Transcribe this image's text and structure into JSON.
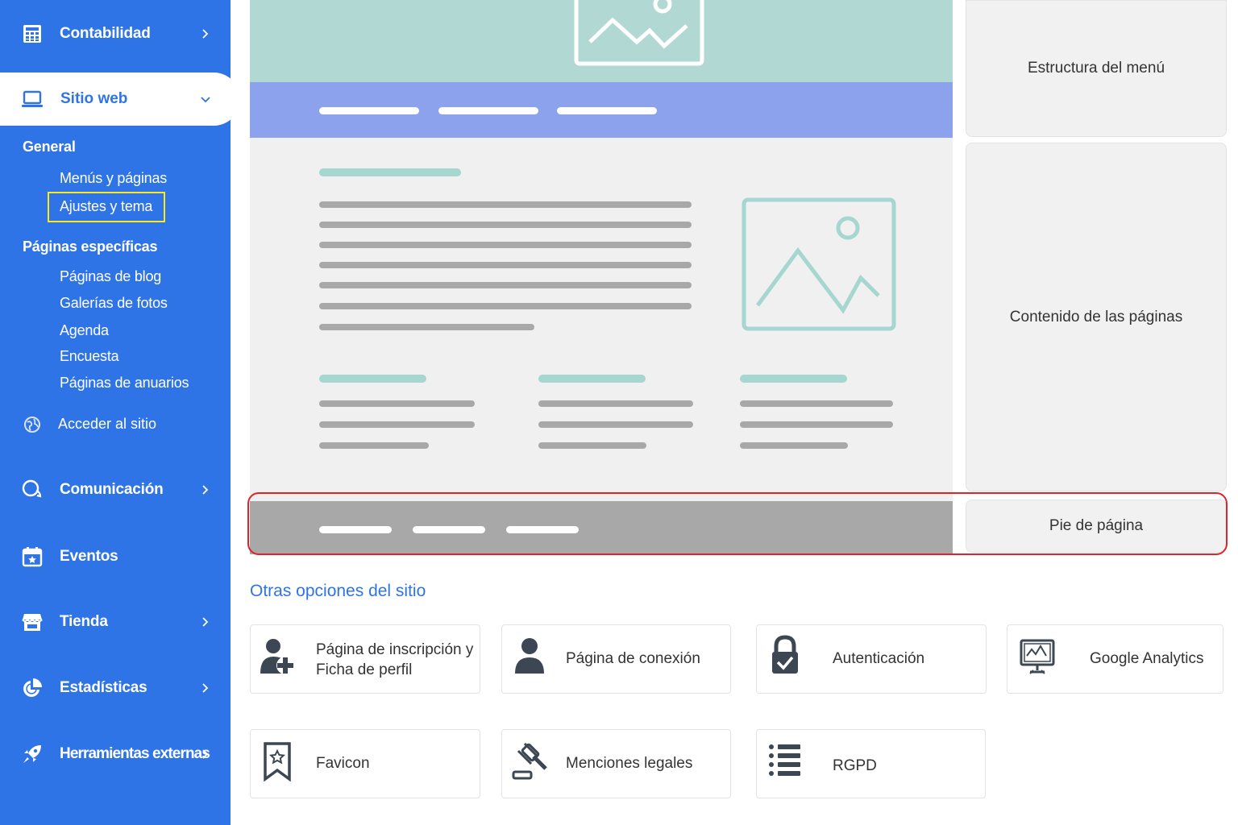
{
  "sidebar": {
    "contabilidad": "Contabilidad",
    "sitio_web": "Sitio web",
    "general_title": "General",
    "general_items": [
      "Menús y páginas",
      "Ajustes y tema"
    ],
    "specific_title": "Páginas específicas",
    "specific_items": [
      "Páginas de blog",
      "Galerías de fotos",
      "Agenda",
      "Encuesta",
      "Páginas de anuarios"
    ],
    "access_site": "Acceder al sitio",
    "comunicacion": "Comunicación",
    "eventos": "Eventos",
    "tienda": "Tienda",
    "estadisticas": "Estadísticas",
    "herramientas": "Herramientas externas"
  },
  "zones": {
    "menu": "Estructura del menú",
    "content": "Contenido de las páginas",
    "footer": "Pie de página"
  },
  "other_options": {
    "title": "Otras opciones del sitio",
    "cards": [
      {
        "label_line1": "Página de inscripción y",
        "label_line2": "Ficha de perfil",
        "icon": "user-add-icon"
      },
      {
        "label": "Página de conexión",
        "icon": "user-icon"
      },
      {
        "label": "Autenticación",
        "icon": "lock-check-icon"
      },
      {
        "label": "Google Analytics",
        "icon": "monitor-chart-icon"
      },
      {
        "label": "Favicon",
        "icon": "bookmark-star-icon"
      },
      {
        "label": "Menciones legales",
        "icon": "gavel-icon"
      },
      {
        "label": "RGPD",
        "icon": "list-icon"
      }
    ]
  },
  "colors": {
    "sidebar": "#2f74e6",
    "highlight": "#ffe81a",
    "footer_outline": "#e1222a",
    "hero": "#b1d8d2",
    "navbar": "#8ca2ed"
  }
}
